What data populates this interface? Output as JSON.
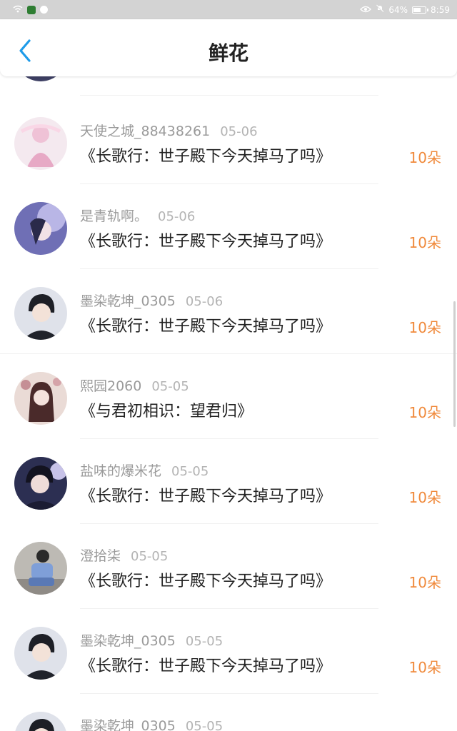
{
  "status_bar": {
    "battery_percent": "64%",
    "battery_level": 0.64,
    "time": "8:59"
  },
  "header": {
    "title": "鲜花"
  },
  "colors": {
    "accent_back": "#1e9be9",
    "gift_count": "#f08a3c"
  },
  "items": [
    {
      "user": "天使之城_88438261",
      "date": "05-06",
      "book": "《长歌行：世子殿下今天掉马了吗》",
      "gift": "10朵"
    },
    {
      "user": "是青轨啊。",
      "date": "05-06",
      "book": "《长歌行：世子殿下今天掉马了吗》",
      "gift": "10朵"
    },
    {
      "user": "墨染乾坤_0305",
      "date": "05-06",
      "book": "《长歌行：世子殿下今天掉马了吗》",
      "gift": "10朵"
    },
    {
      "user": "熙园2060",
      "date": "05-05",
      "book": "《与君初相识：望君归》",
      "gift": "10朵"
    },
    {
      "user": "盐味的爆米花",
      "date": "05-05",
      "book": "《长歌行：世子殿下今天掉马了吗》",
      "gift": "10朵"
    },
    {
      "user": "澄拾柒",
      "date": "05-05",
      "book": "《长歌行：世子殿下今天掉马了吗》",
      "gift": "10朵"
    },
    {
      "user": "墨染乾坤_0305",
      "date": "05-05",
      "book": "《长歌行：世子殿下今天掉马了吗》",
      "gift": "10朵"
    },
    {
      "user": "墨染乾坤_0305",
      "date": "05-05",
      "book": "",
      "gift": ""
    }
  ]
}
